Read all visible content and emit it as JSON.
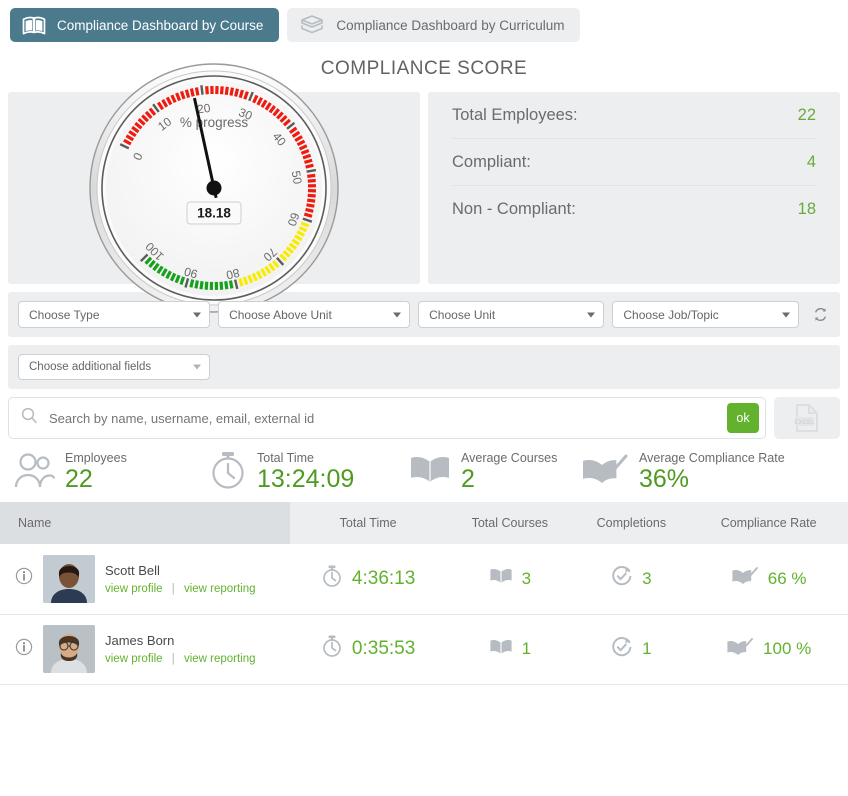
{
  "tabs": [
    {
      "label": "Compliance Dashboard by Course",
      "icon": "open-book-icon",
      "active": true
    },
    {
      "label": "Compliance Dashboard by Curriculum",
      "icon": "stacked-books-icon",
      "active": false
    }
  ],
  "page_title": "COMPLIANCE SCORE",
  "gauge": {
    "value": "18.18",
    "caption": "% progress",
    "ticks": [
      "0",
      "10",
      "20",
      "30",
      "40",
      "50",
      "60",
      "70",
      "80",
      "90",
      "100"
    ],
    "min": 0,
    "max": 100,
    "zones": [
      {
        "from": 0,
        "to": 60,
        "color": "#ee1c10"
      },
      {
        "from": 60,
        "to": 80,
        "color": "#f7ec00"
      },
      {
        "from": 80,
        "to": 100,
        "color": "#16a11c"
      }
    ]
  },
  "stats": [
    {
      "label": "Total Employees:",
      "value": "22"
    },
    {
      "label": "Compliant:",
      "value": "4"
    },
    {
      "label": "Non - Compliant:",
      "value": "18"
    }
  ],
  "filters": {
    "type": "Choose Type",
    "above_unit": "Choose Above Unit",
    "unit": "Choose Unit",
    "job_topic": "Choose Job/Topic",
    "additional_fields": "Choose additional fields",
    "refresh_icon": "refresh-icon"
  },
  "search": {
    "placeholder": "Search by name, username, email, external id",
    "value": "",
    "ok_label": "ok",
    "export_label": "EXCEL"
  },
  "kpis": [
    {
      "label": "Employees",
      "value": "22",
      "icon": "people-icon"
    },
    {
      "label": "Total Time",
      "value": "13:24:09",
      "icon": "stopwatch-icon"
    },
    {
      "label": "Average Courses",
      "value": "2",
      "icon": "open-book-icon"
    },
    {
      "label": "Average Compliance Rate",
      "value": "36%",
      "icon": "book-check-icon"
    }
  ],
  "table": {
    "columns": [
      "Name",
      "Total Time",
      "Total Courses",
      "Completions",
      "Compliance Rate"
    ],
    "row_links": {
      "profile": "view profile",
      "reporting": "view reporting"
    },
    "rows": [
      {
        "name": "Scott Bell",
        "total_time": "4:36:13",
        "total_courses": "3",
        "completions": "3",
        "compliance_rate": "66 %",
        "avatar": "photo-man-suit"
      },
      {
        "name": "James Born",
        "total_time": "0:35:53",
        "total_courses": "1",
        "completions": "1",
        "compliance_rate": "100 %",
        "avatar": "photo-man-glasses"
      }
    ]
  },
  "colors": {
    "accent_green": "#62b22e",
    "tab_active": "#4a7a8c",
    "panel_gray": "#eceef0"
  }
}
